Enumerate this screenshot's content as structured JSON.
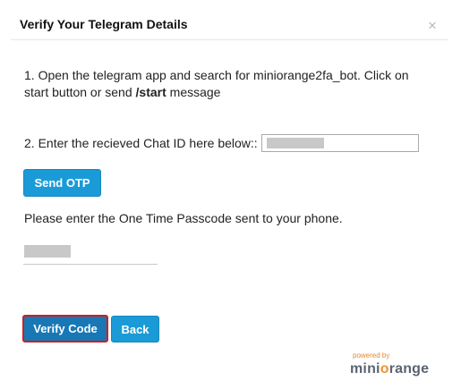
{
  "dialog": {
    "title": "Verify Your Telegram Details",
    "close_glyph": "×"
  },
  "instructions": {
    "step1_prefix": "1. Open the telegram app and search for miniorange2fa_bot. Click on start button or send ",
    "step1_command": "/start",
    "step1_suffix": " message",
    "step2_label": "2. Enter the recieved Chat ID here below::"
  },
  "chat_id_input": {
    "value": "",
    "redacted": true
  },
  "buttons": {
    "send_otp": "Send OTP",
    "verify_code": "Verify Code",
    "back": "Back"
  },
  "otp_prompt": "Please enter the One Time Passcode sent to your phone.",
  "otp_input": {
    "value": "",
    "redacted": true
  },
  "branding": {
    "powered_by": "powered by",
    "logo_part1": "mini",
    "logo_o": "o",
    "logo_part2": "range"
  },
  "colors": {
    "button_blue": "#1a9bd7",
    "verify_blue": "#1778b5",
    "focus_red": "#d81b1b",
    "brand_orange": "#f0912f"
  }
}
